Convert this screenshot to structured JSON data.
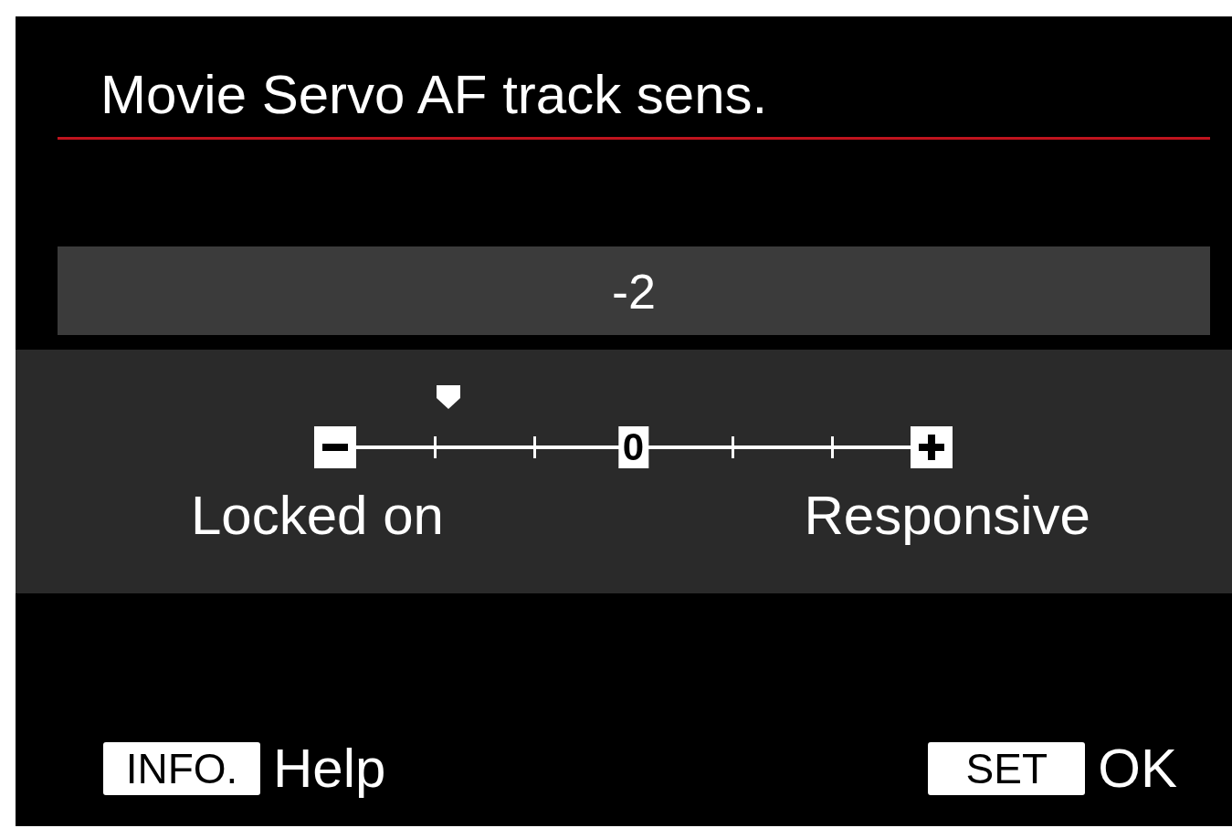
{
  "title": "Movie Servo AF track sens.",
  "value": "-2",
  "scale": {
    "level": 0.1667,
    "center_label": "0",
    "min_label": "Locked on",
    "max_label": "Responsive"
  },
  "footer": [
    {
      "key": "INFO.",
      "label": "Help"
    },
    {
      "key": "SET",
      "label": "OK"
    }
  ]
}
